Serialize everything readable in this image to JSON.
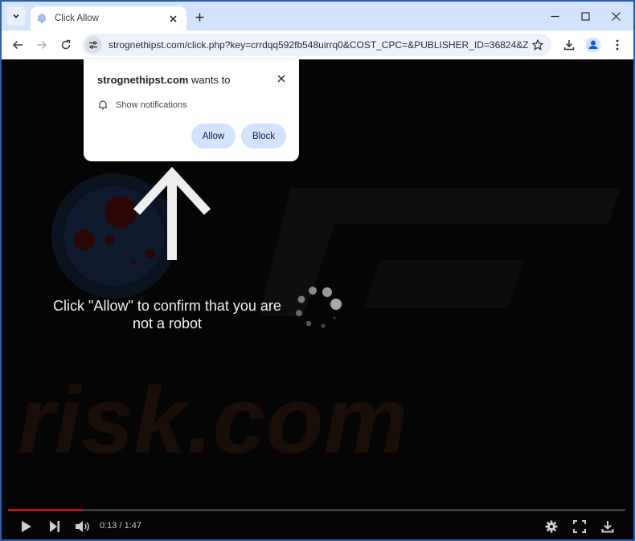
{
  "browser": {
    "tab": {
      "title": "Click Allow",
      "favicon": "bell-favicon-icon"
    },
    "new_tab_icon": "plus-icon",
    "window_controls": [
      "minimize-icon",
      "maximize-icon",
      "close-icon"
    ],
    "toolbar": {
      "back_icon": "arrow-left-icon",
      "forward_icon": "arrow-right-icon",
      "reload_icon": "reload-icon",
      "site_info_icon": "tune-icon",
      "url": "strognethipst.com/click.php?key=crrdqq592fb548uirrq0&COST_CPC=&PUBLISHER_ID=36824&ZO...",
      "bookmark_icon": "star-icon",
      "download_icon": "download-icon",
      "profile_icon": "person-icon",
      "menu_icon": "kebab-menu-icon"
    }
  },
  "permission_popup": {
    "site": "strognethipst.com",
    "wants_to": " wants to",
    "permission": "Show notifications",
    "allow_label": "Allow",
    "block_label": "Block"
  },
  "page": {
    "message": "Click \"Allow\" to confirm that you are not a robot",
    "watermark": "PC risk.com"
  },
  "video": {
    "current_time": "0:13",
    "duration": "1:47",
    "time_display": "0:13 / 1:47",
    "progress_fraction": 0.12,
    "accent_color": "#b01818"
  }
}
